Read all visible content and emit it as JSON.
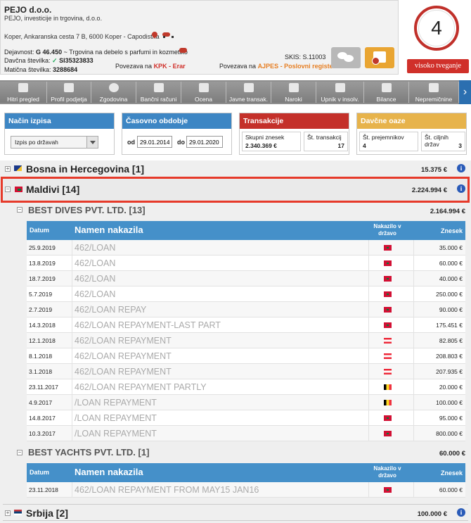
{
  "company": {
    "name": "PEJO d.o.o.",
    "full_name": "PEJO, investicije in trgovina, d.o.o.",
    "address": "Koper, Ankaranska cesta 7 B, 6000 Koper - Capodistria",
    "activity_label": "Dejavnost:",
    "activity_code": "G 46.450",
    "activity_desc": "~ Trgovina na debelo s parfumi in kozmetiko",
    "tax_label": "Davčna številka:",
    "tax_number": "SI35323833",
    "reg_label": "Matična številka:",
    "reg_number": "3288684",
    "kpk_prefix": "Povezava na",
    "kpk_link": "KPK - Erar",
    "ajpes_prefix": "Povezava na",
    "ajpes_link": "AJPES - Poslovni register",
    "skis": "SKIS: S.11003"
  },
  "score": {
    "value": "4",
    "risk_label": "visoko tveganje"
  },
  "tabs": [
    {
      "label": "Hitri pregled"
    },
    {
      "label": "Profil podjetja"
    },
    {
      "label": "Zgodovina"
    },
    {
      "label": "Bančni računi"
    },
    {
      "label": "Ocena"
    },
    {
      "label": "Javne transak."
    },
    {
      "label": "Naroki"
    },
    {
      "label": "Upnik v insolv."
    },
    {
      "label": "Bilance"
    },
    {
      "label": "Nepremičnine"
    }
  ],
  "filters": {
    "mode_title": "Način izpisa",
    "mode_value": "Izpis po državah",
    "period_title": "Časovno obdobje",
    "from_label": "od",
    "from_value": "29.01.2014",
    "to_label": "do",
    "to_value": "29.01.2020"
  },
  "transactions": {
    "title": "Transakcije",
    "total_label": "Skupni znesek",
    "total_value": "2.340.369 €",
    "count_label": "Št. transakcij",
    "count_value": "17"
  },
  "tax_havens": {
    "title": "Davčne oaze",
    "recipients_label": "Št. prejemnikov",
    "recipients_value": "4",
    "countries_label": "Št. ciljnih držav",
    "countries_value": "3"
  },
  "table_headers": {
    "date": "Datum",
    "purpose": "Namen nakazila",
    "country_line1": "Nakazilo v",
    "country_line2": "državo",
    "amount": "Znesek"
  },
  "countries": [
    {
      "name": "Bosna in Hercegovina [1]",
      "amount": "15.375 €",
      "toggle": "+"
    },
    {
      "name": "Maldivi [14]",
      "amount": "2.224.994 €",
      "toggle": "−"
    },
    {
      "name": "Srbija [2]",
      "amount": "100.000 €",
      "toggle": "+"
    }
  ],
  "recipients": [
    {
      "name": "BEST DIVES PVT. LTD. [13]",
      "amount": "2.164.994 €",
      "rows": [
        {
          "date": "25.9.2019",
          "purpose": "462/LOAN",
          "flag": "mv",
          "amount": "35.000 €"
        },
        {
          "date": "13.8.2019",
          "purpose": "462/LOAN",
          "flag": "mv",
          "amount": "60.000 €"
        },
        {
          "date": "18.7.2019",
          "purpose": "462/LOAN",
          "flag": "mv",
          "amount": "40.000 €"
        },
        {
          "date": "5.7.2019",
          "purpose": "462/LOAN",
          "flag": "mv",
          "amount": "250.000 €"
        },
        {
          "date": "2.7.2019",
          "purpose": "462/LOAN REPAY",
          "flag": "mv",
          "amount": "90.000 €"
        },
        {
          "date": "14.3.2018",
          "purpose": "462/LOAN REPAYMENT-LAST PART",
          "flag": "mv",
          "amount": "175.451 €"
        },
        {
          "date": "12.1.2018",
          "purpose": "462/LOAN REPAYMENT",
          "flag": "at",
          "amount": "82.805 €"
        },
        {
          "date": "8.1.2018",
          "purpose": "462/LOAN REPAYMENT",
          "flag": "at",
          "amount": "208.803 €"
        },
        {
          "date": "3.1.2018",
          "purpose": "462/LOAN REPAYMENT",
          "flag": "at",
          "amount": "207.935 €"
        },
        {
          "date": "23.11.2017",
          "purpose": "462/LOAN REPAYMENT PARTLY",
          "flag": "be",
          "amount": "20.000 €"
        },
        {
          "date": "4.9.2017",
          "purpose": "/LOAN REPAYMENT",
          "flag": "be",
          "amount": "100.000 €"
        },
        {
          "date": "14.8.2017",
          "purpose": "/LOAN REPAYMENT",
          "flag": "mv",
          "amount": "95.000 €"
        },
        {
          "date": "10.3.2017",
          "purpose": "/LOAN REPAYMENT",
          "flag": "mv",
          "amount": "800.000 €"
        }
      ]
    },
    {
      "name": "BEST YACHTS PVT. LTD. [1]",
      "amount": "60.000 €",
      "rows": [
        {
          "date": "23.11.2018",
          "purpose": "462/LOAN REPAYMENT FROM MAY15 JAN16",
          "flag": "mv",
          "amount": "60.000 €"
        }
      ]
    }
  ],
  "colors": {
    "accent_blue": "#4590c9",
    "red": "#c4302a",
    "yellow": "#e7b34b",
    "highlight": "#e63a2a"
  }
}
